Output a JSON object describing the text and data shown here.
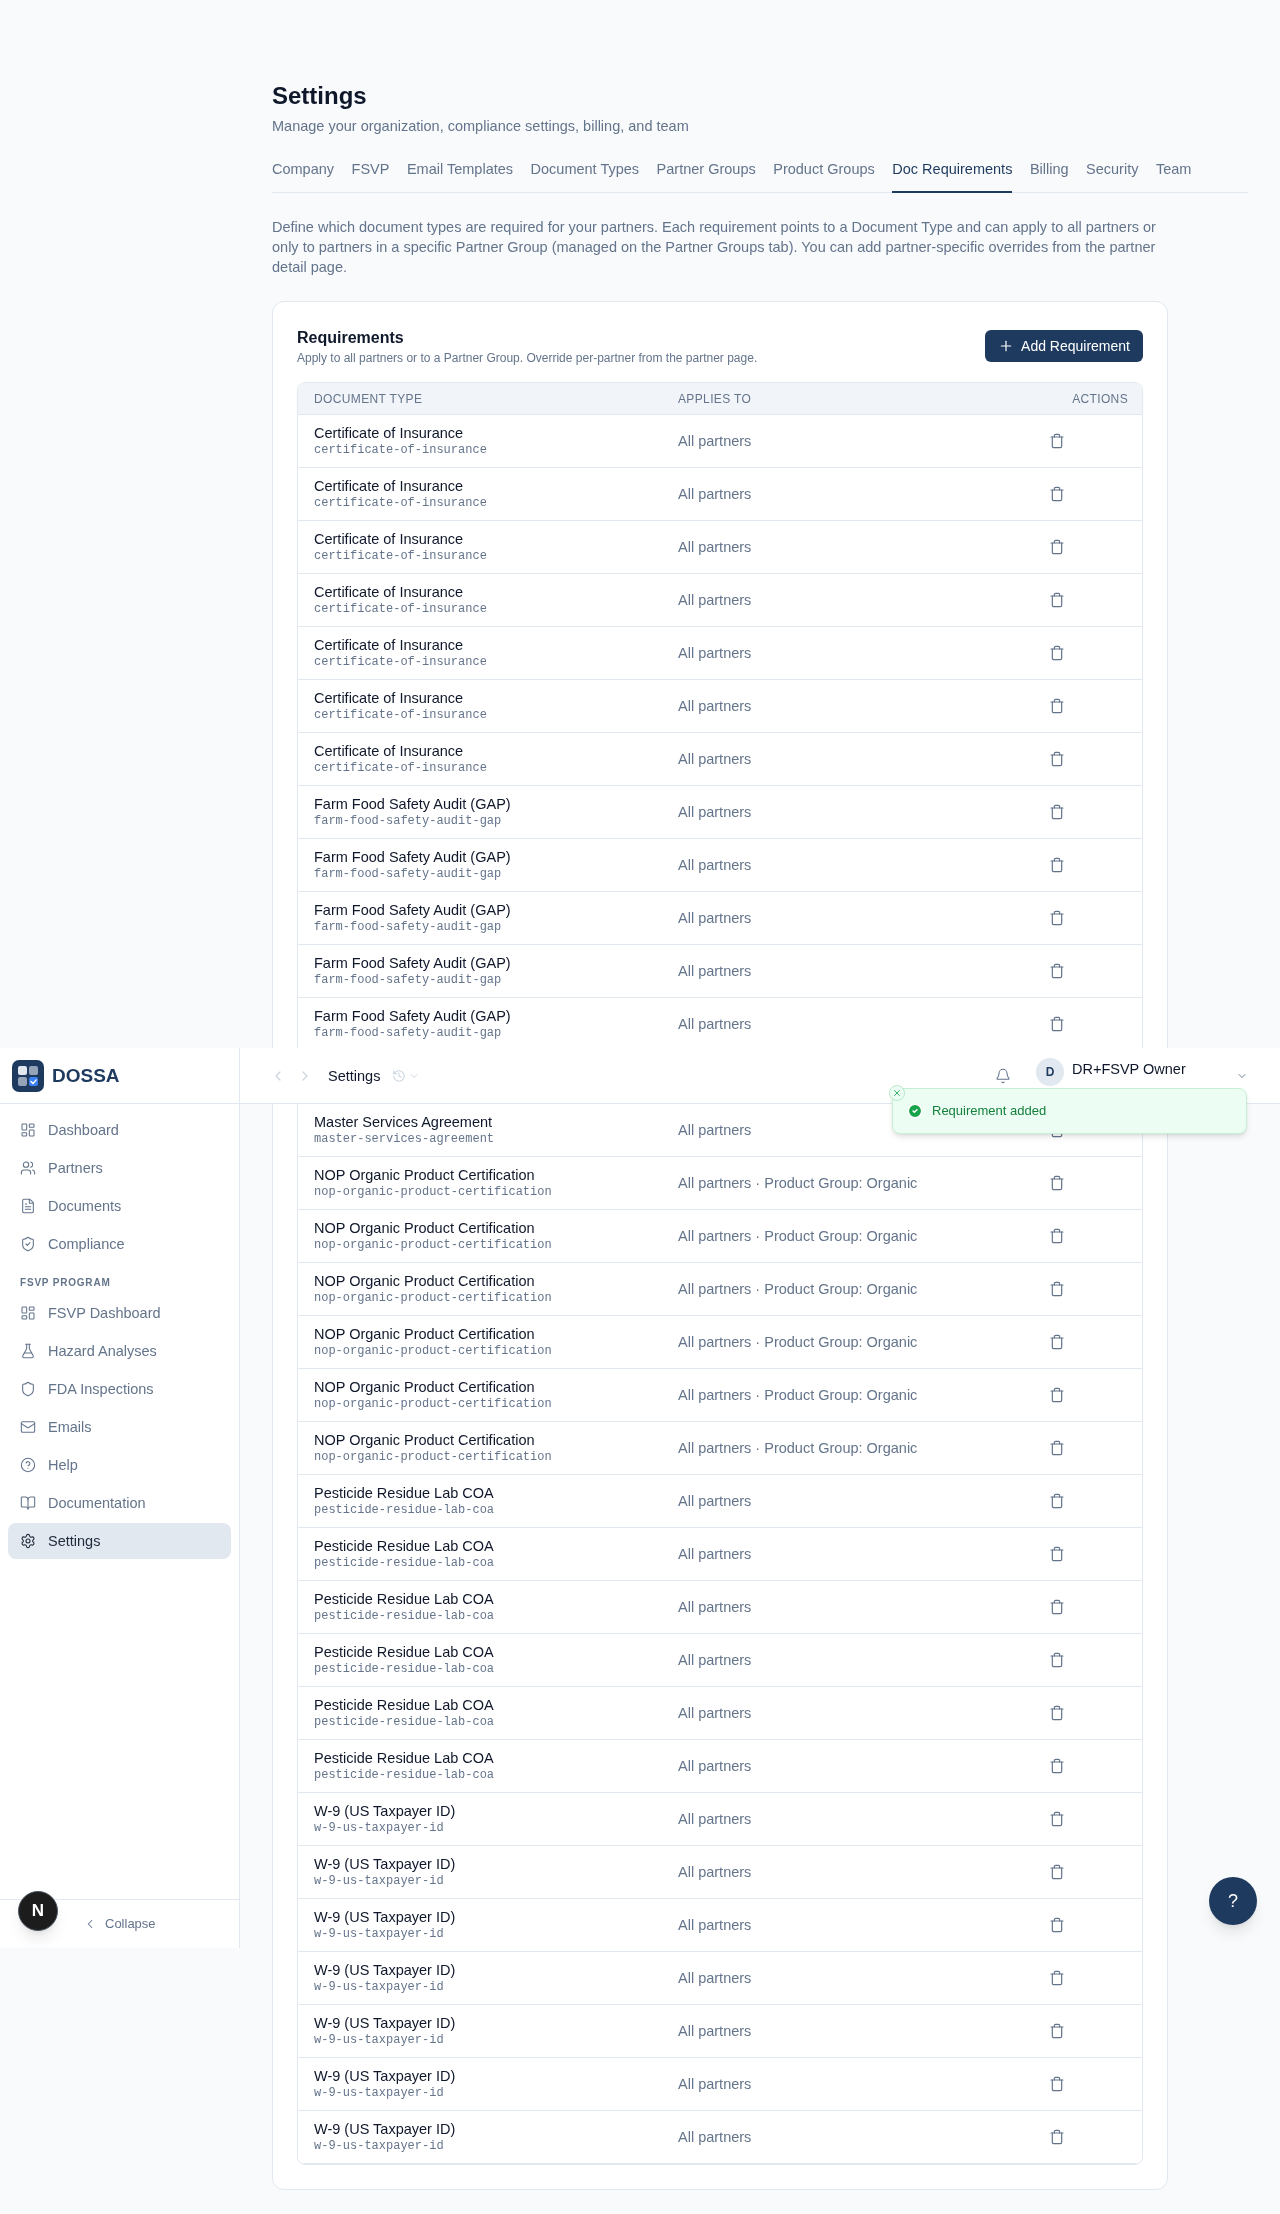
{
  "page": {
    "title": "Settings",
    "subtitle": "Manage your organization, compliance settings, billing, and team"
  },
  "tabs": [
    {
      "label": "Company",
      "selected": false
    },
    {
      "label": "FSVP",
      "selected": false
    },
    {
      "label": "Email Templates",
      "selected": false
    },
    {
      "label": "Document Types",
      "selected": false
    },
    {
      "label": "Partner Groups",
      "selected": false
    },
    {
      "label": "Product Groups",
      "selected": false
    },
    {
      "label": "Doc Requirements",
      "selected": true
    },
    {
      "label": "Billing",
      "selected": false
    },
    {
      "label": "Security",
      "selected": false
    },
    {
      "label": "Team",
      "selected": false
    }
  ],
  "description": "Define which document types are required for your partners. Each requirement points to a Document Type and can apply to all partners or only to partners in a specific Partner Group (managed on the Partner Groups tab). You can add partner-specific overrides from the partner detail page.",
  "requirements": {
    "title": "Requirements",
    "subtitle": "Apply to all partners or to a Partner Group. Override per-partner from the partner page.",
    "add_button": "Add Requirement",
    "table": {
      "columns": [
        "DOCUMENT TYPE",
        "APPLIES TO",
        "ACTIONS"
      ],
      "rows": [
        {
          "name": "Certificate of Insurance",
          "slug": "certificate-of-insurance",
          "applies_to": "All partners"
        },
        {
          "name": "Certificate of Insurance",
          "slug": "certificate-of-insurance",
          "applies_to": "All partners"
        },
        {
          "name": "Certificate of Insurance",
          "slug": "certificate-of-insurance",
          "applies_to": "All partners"
        },
        {
          "name": "Certificate of Insurance",
          "slug": "certificate-of-insurance",
          "applies_to": "All partners"
        },
        {
          "name": "Certificate of Insurance",
          "slug": "certificate-of-insurance",
          "applies_to": "All partners"
        },
        {
          "name": "Certificate of Insurance",
          "slug": "certificate-of-insurance",
          "applies_to": "All partners"
        },
        {
          "name": "Certificate of Insurance",
          "slug": "certificate-of-insurance",
          "applies_to": "All partners"
        },
        {
          "name": "Farm Food Safety Audit (GAP)",
          "slug": "farm-food-safety-audit-gap",
          "applies_to": "All partners"
        },
        {
          "name": "Farm Food Safety Audit (GAP)",
          "slug": "farm-food-safety-audit-gap",
          "applies_to": "All partners"
        },
        {
          "name": "Farm Food Safety Audit (GAP)",
          "slug": "farm-food-safety-audit-gap",
          "applies_to": "All partners"
        },
        {
          "name": "Farm Food Safety Audit (GAP)",
          "slug": "farm-food-safety-audit-gap",
          "applies_to": "All partners"
        },
        {
          "name": "Farm Food Safety Audit (GAP)",
          "slug": "farm-food-safety-audit-gap",
          "applies_to": "All partners"
        }
      ],
      "rows_below_top_bar": [
        {
          "name": "Master Services Agreement",
          "slug": "master-services-agreement",
          "applies_to": "All partners"
        },
        {
          "name": "NOP Organic Product Certification",
          "slug": "nop-organic-product-certification",
          "applies_to": "All partners · Product Group: Organic"
        },
        {
          "name": "NOP Organic Product Certification",
          "slug": "nop-organic-product-certification",
          "applies_to": "All partners · Product Group: Organic"
        },
        {
          "name": "NOP Organic Product Certification",
          "slug": "nop-organic-product-certification",
          "applies_to": "All partners · Product Group: Organic"
        },
        {
          "name": "NOP Organic Product Certification",
          "slug": "nop-organic-product-certification",
          "applies_to": "All partners · Product Group: Organic"
        },
        {
          "name": "NOP Organic Product Certification",
          "slug": "nop-organic-product-certification",
          "applies_to": "All partners · Product Group: Organic"
        },
        {
          "name": "NOP Organic Product Certification",
          "slug": "nop-organic-product-certification",
          "applies_to": "All partners · Product Group: Organic"
        },
        {
          "name": "Pesticide Residue Lab COA",
          "slug": "pesticide-residue-lab-coa",
          "applies_to": "All partners"
        },
        {
          "name": "Pesticide Residue Lab COA",
          "slug": "pesticide-residue-lab-coa",
          "applies_to": "All partners"
        },
        {
          "name": "Pesticide Residue Lab COA",
          "slug": "pesticide-residue-lab-coa",
          "applies_to": "All partners"
        },
        {
          "name": "Pesticide Residue Lab COA",
          "slug": "pesticide-residue-lab-coa",
          "applies_to": "All partners"
        },
        {
          "name": "Pesticide Residue Lab COA",
          "slug": "pesticide-residue-lab-coa",
          "applies_to": "All partners"
        },
        {
          "name": "Pesticide Residue Lab COA",
          "slug": "pesticide-residue-lab-coa",
          "applies_to": "All partners"
        },
        {
          "name": "W-9 (US Taxpayer ID)",
          "slug": "w-9-us-taxpayer-id",
          "applies_to": "All partners"
        },
        {
          "name": "W-9 (US Taxpayer ID)",
          "slug": "w-9-us-taxpayer-id",
          "applies_to": "All partners"
        },
        {
          "name": "W-9 (US Taxpayer ID)",
          "slug": "w-9-us-taxpayer-id",
          "applies_to": "All partners"
        },
        {
          "name": "W-9 (US Taxpayer ID)",
          "slug": "w-9-us-taxpayer-id",
          "applies_to": "All partners"
        },
        {
          "name": "W-9 (US Taxpayer ID)",
          "slug": "w-9-us-taxpayer-id",
          "applies_to": "All partners"
        },
        {
          "name": "W-9 (US Taxpayer ID)",
          "slug": "w-9-us-taxpayer-id",
          "applies_to": "All partners"
        },
        {
          "name": "W-9 (US Taxpayer ID)",
          "slug": "w-9-us-taxpayer-id",
          "applies_to": "All partners"
        }
      ]
    }
  },
  "sidebar": {
    "brand": "DOSSA",
    "groups": [
      {
        "items": [
          {
            "label": "Dashboard",
            "selected": false
          },
          {
            "label": "Partners",
            "selected": false
          },
          {
            "label": "Documents",
            "selected": false
          },
          {
            "label": "Compliance",
            "selected": false
          }
        ]
      },
      {
        "label": "FSVP PROGRAM",
        "items": [
          {
            "label": "FSVP Dashboard",
            "selected": false
          },
          {
            "label": "Hazard Analyses",
            "selected": false
          },
          {
            "label": "FDA Inspections",
            "selected": false
          },
          {
            "label": "Emails",
            "selected": false
          },
          {
            "label": "Help",
            "selected": false
          },
          {
            "label": "Documentation",
            "selected": false
          },
          {
            "label": "Settings",
            "selected": true
          }
        ]
      }
    ],
    "collapse_label": "Collapse"
  },
  "top_bar": {
    "title": "Settings",
    "user": {
      "initial": "D",
      "name": "DR+FSVP Owner"
    }
  },
  "toast": {
    "message": "Requirement added"
  },
  "dev_badge": {
    "label": "N"
  },
  "help_button": {
    "label": "?"
  }
}
